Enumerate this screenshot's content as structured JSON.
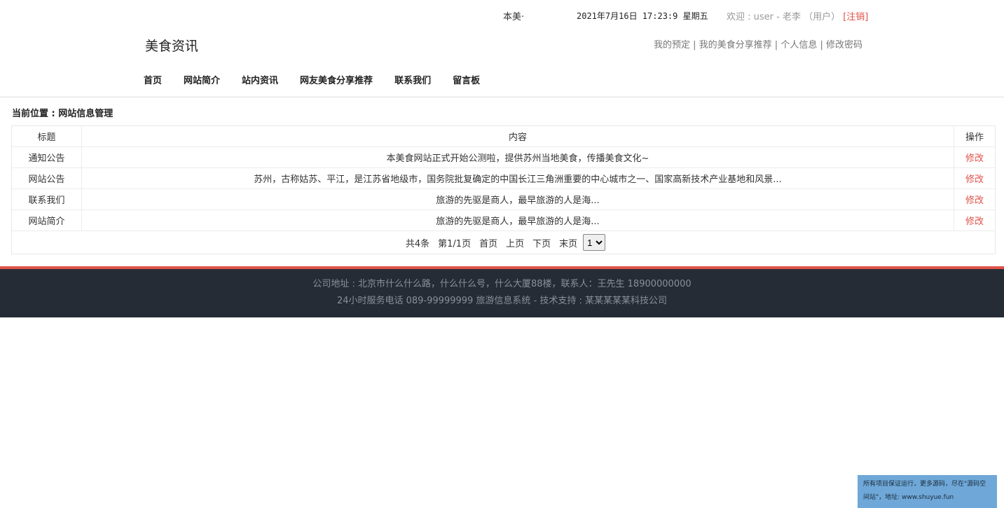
{
  "topbar": {
    "marquee": "本美·",
    "datetime": "2021年7月16日 17:23:9 星期五",
    "welcome": "欢迎 : user - 老李 （用户）",
    "logout": "[注销]"
  },
  "header": {
    "site_title": "美食资讯",
    "user_links": [
      "我的预定",
      "我的美食分享推荐",
      "个人信息",
      "修改密码"
    ]
  },
  "nav": [
    "首页",
    "网站简介",
    "站内资讯",
    "网友美食分享推荐",
    "联系我们",
    "留言板"
  ],
  "breadcrumb": "当前位置 : 网站信息管理",
  "table": {
    "headers": [
      "标题",
      "内容",
      "操作"
    ],
    "rows": [
      {
        "title": "通知公告",
        "content": "本美食网站正式开始公测啦，提供苏州当地美食，传播美食文化~",
        "action": "修改"
      },
      {
        "title": "网站公告",
        "content": "苏州，古称姑苏、平江，是江苏省地级市，国务院批复确定的中国长江三角洲重要的中心城市之一、国家高新技术产业基地和风景...",
        "action": "修改"
      },
      {
        "title": "联系我们",
        "content": "旅游的先驱是商人，最早旅游的人是海...",
        "action": "修改"
      },
      {
        "title": "网站简介",
        "content": "旅游的先驱是商人，最早旅游的人是海...",
        "action": "修改"
      }
    ]
  },
  "pager": {
    "total": "共4条",
    "page_info": "第1/1页",
    "first": "首页",
    "prev": "上页",
    "next": "下页",
    "last": "末页",
    "selected": "1"
  },
  "footer": {
    "line1": "公司地址 : 北京市什么什么路，什么什么号，什么大厦88楼，联系人：王先生 18900000000",
    "line2": "24小时服务电话   089-99999999   旅游信息系统 - 技术支持 : 某某某某某科技公司"
  },
  "corner_note": "所有项目保证运行，更多源码，尽在\"源码空间站\"，地址: www.shuyue.fun",
  "colors": {
    "accent": "#e0524a",
    "footer_bg": "#262c36",
    "corner_bg": "#6fa8d8"
  }
}
